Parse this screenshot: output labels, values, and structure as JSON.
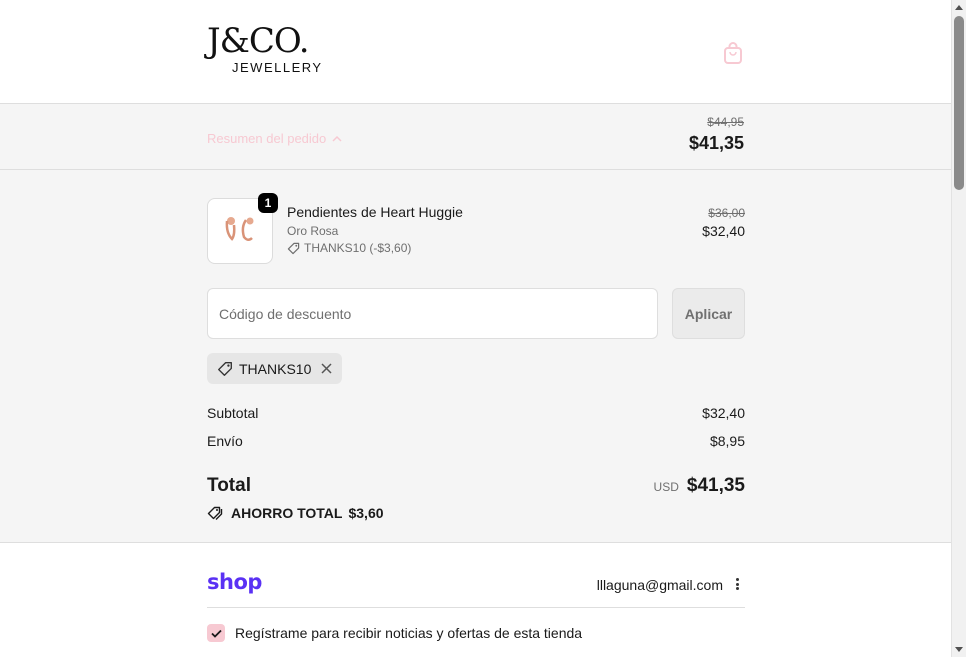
{
  "brand": {
    "logo_main": "J&CO.",
    "logo_sub": "JEWELLERY"
  },
  "summary": {
    "toggle_label": "Resumen del pedido",
    "original_total": "$44,95",
    "total": "$41,35"
  },
  "item": {
    "quantity": "1",
    "name": "Pendientes de Heart Huggie",
    "variant": "Oro Rosa",
    "discount": "THANKS10 (-$3,60)",
    "original_price": "$36,00",
    "price": "$32,40"
  },
  "discount_form": {
    "placeholder": "Código de descuento",
    "value": "",
    "apply_label": "Aplicar"
  },
  "applied_code": {
    "code": "THANKS10"
  },
  "totals": {
    "subtotal_label": "Subtotal",
    "subtotal_value": "$32,40",
    "shipping_label": "Envío",
    "shipping_value": "$8,95",
    "total_label": "Total",
    "currency": "USD",
    "total_value": "$41,35",
    "savings_label": "AHORRO TOTAL",
    "savings_value": "$3,60"
  },
  "shop_account": {
    "logo": "shop",
    "email": "lllaguna@gmail.com"
  },
  "newsletter": {
    "label": "Regístrame para recibir noticias y ofertas de esta tienda",
    "checked": true
  },
  "colors": {
    "accent_pink": "#f7c9d2",
    "shop_purple": "#5a31f4",
    "panel_bg": "#f5f5f5"
  }
}
